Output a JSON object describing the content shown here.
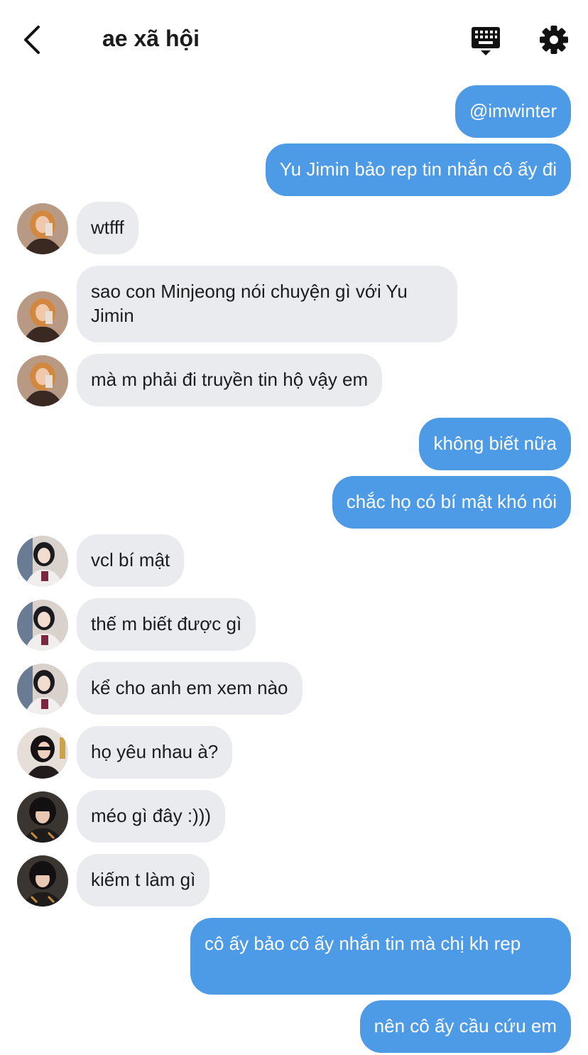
{
  "header": {
    "title": "ae xã hội",
    "back_icon": "chevron-left-icon",
    "keyboard_icon": "keyboard-icon",
    "settings_icon": "gear-icon"
  },
  "colors": {
    "outgoing_bubble": "#4d9be6",
    "incoming_bubble": "#e9ebef",
    "text_dark": "#1c1c1e"
  },
  "messages": [
    {
      "side": "out",
      "text": "@imwinter"
    },
    {
      "side": "out",
      "text": "Yu Jimin bảo rep tin nhắn cô ấy đi"
    },
    {
      "side": "in",
      "avatar": "avatar-1",
      "text": "wtfff"
    },
    {
      "side": "in",
      "avatar": "avatar-1",
      "text": "sao con Minjeong nói chuyện gì với Yu Jimin"
    },
    {
      "side": "in",
      "avatar": "avatar-1",
      "text": "mà m phải đi truyền tin hộ vậy em"
    },
    {
      "side": "out",
      "text": "không biết nữa"
    },
    {
      "side": "out",
      "text": "chắc họ có bí mật khó nói"
    },
    {
      "side": "in",
      "avatar": "avatar-2",
      "text": "vcl bí mật"
    },
    {
      "side": "in",
      "avatar": "avatar-2",
      "text": "thế m biết được gì"
    },
    {
      "side": "in",
      "avatar": "avatar-2",
      "text": "kể cho anh em xem nào"
    },
    {
      "side": "in",
      "avatar": "avatar-3",
      "text": "họ yêu nhau à?"
    },
    {
      "side": "in",
      "avatar": "avatar-4",
      "text": "méo gì đây :)))"
    },
    {
      "side": "in",
      "avatar": "avatar-4",
      "text": "kiếm t làm gì"
    },
    {
      "side": "out",
      "text": "cô ấy bảo cô ấy nhắn tin mà chị kh rep"
    },
    {
      "side": "out",
      "text": "nên cô ấy cầu cứu em"
    }
  ]
}
